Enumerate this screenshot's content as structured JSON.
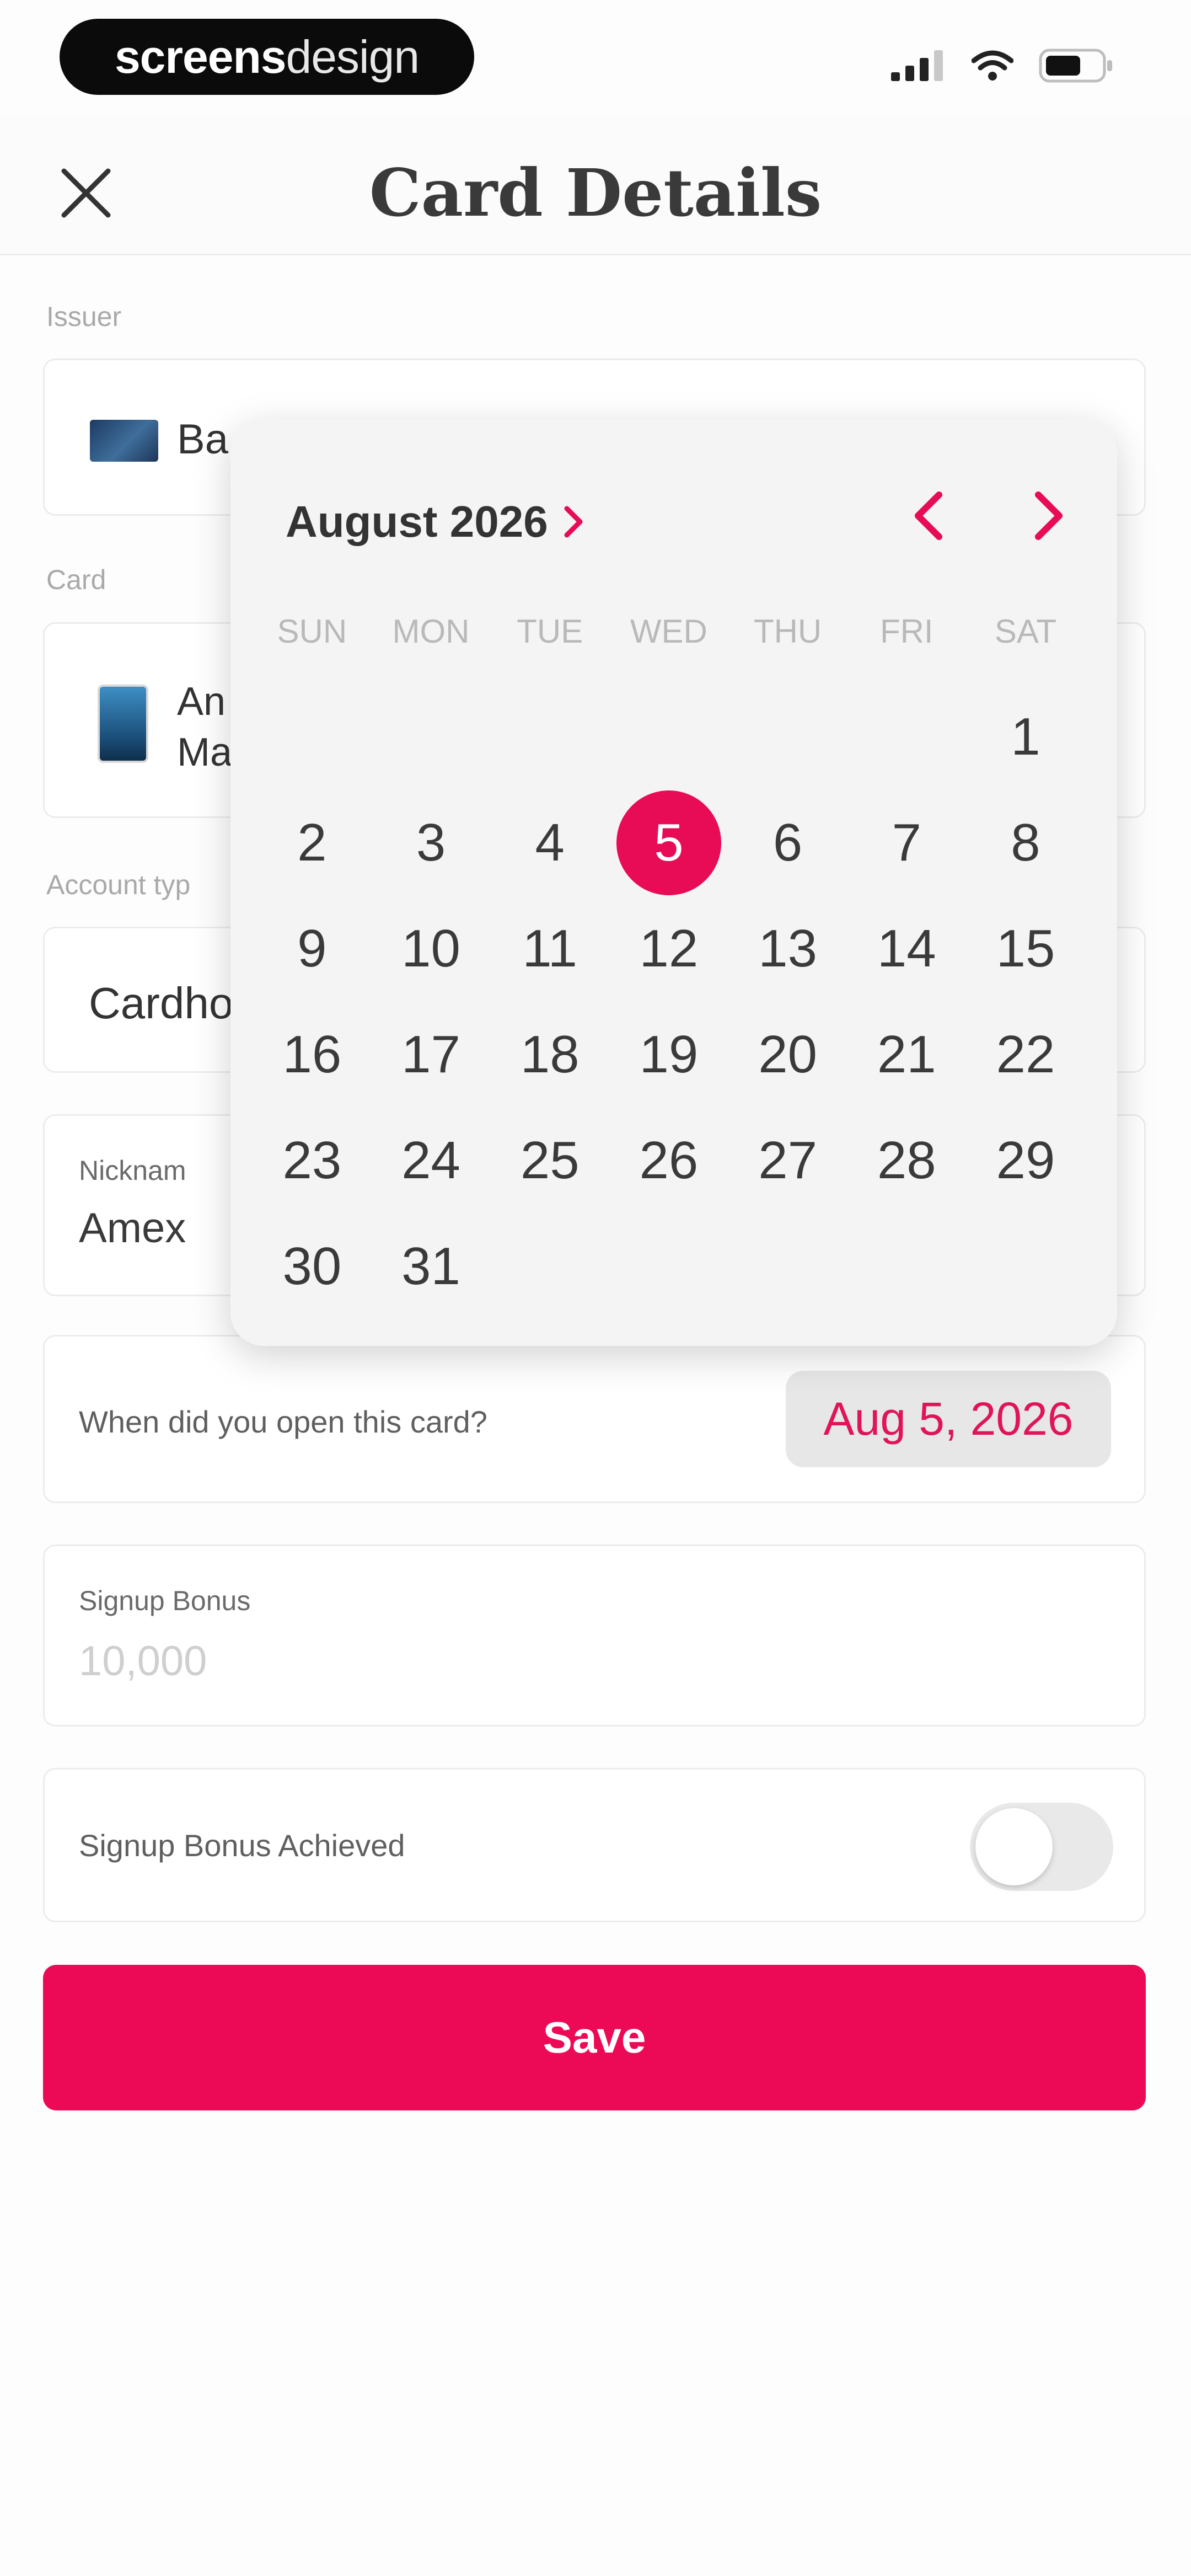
{
  "brand": {
    "bold": "screens",
    "light": "design"
  },
  "header": {
    "title": "Card Details"
  },
  "form": {
    "issuer_label": "Issuer",
    "issuer_value": "Ba",
    "card_label": "Card",
    "card_value_line1": "An",
    "card_value_line2": "Ma",
    "account_label": "Account typ",
    "account_value": "Cardho",
    "nickname_label": "Nicknam",
    "nickname_value": "Amex",
    "opened_question": "When did you open this card?",
    "opened_date": "Aug 5, 2026",
    "bonus_label": "Signup Bonus",
    "bonus_placeholder": "10,000",
    "achieved_label": "Signup Bonus Achieved",
    "achieved_on": false,
    "save_label": "Save"
  },
  "calendar": {
    "month_label": "August 2026",
    "weekdays": [
      "SUN",
      "MON",
      "TUE",
      "WED",
      "THU",
      "FRI",
      "SAT"
    ],
    "first_weekday_index": 6,
    "days_in_month": 31,
    "selected_day": 5
  },
  "colors": {
    "accent": "#e80b55",
    "save_button": "#ec0a56",
    "date_text": "#e0145a"
  },
  "icons": {
    "close": "close-icon",
    "signal": "cellular-signal-icon",
    "wifi": "wifi-icon",
    "battery": "battery-icon",
    "month_expand": "chevron-right-icon",
    "prev": "chevron-left-icon",
    "next": "chevron-right-icon"
  }
}
